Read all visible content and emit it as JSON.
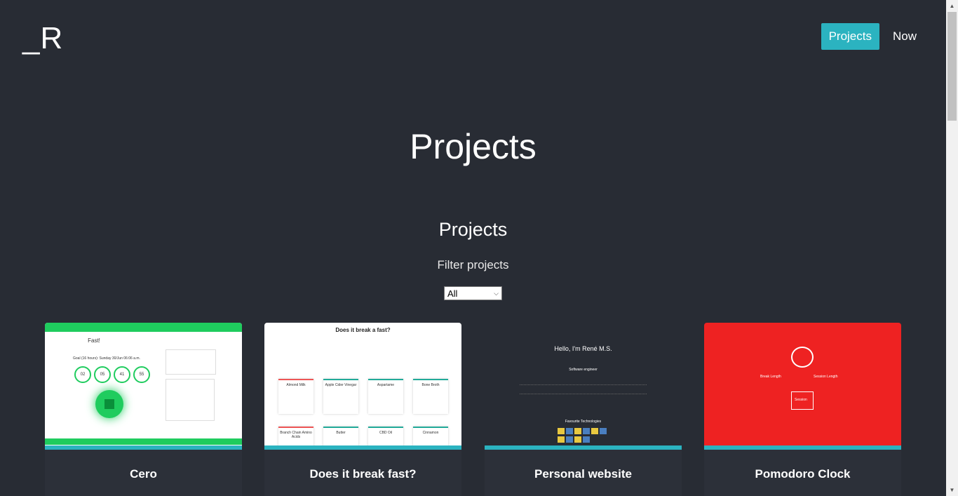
{
  "brand": {
    "logo": "_R"
  },
  "nav": [
    {
      "label": "Projects",
      "active": true
    },
    {
      "label": "Now",
      "active": false
    }
  ],
  "hero": {
    "title": "Projects"
  },
  "section": {
    "title": "Projects",
    "filter_label": "Filter projects"
  },
  "filter": {
    "selected": "All"
  },
  "cards": [
    {
      "name": "Cero"
    },
    {
      "name": "Does it break fast?"
    },
    {
      "name": "Personal website"
    },
    {
      "name": "Pomodoro Clock"
    }
  ],
  "thumbs": {
    "cero": {
      "title": "Fast!",
      "goal": "Goal (16 hours): Sunday 30/Jun 06:06 a.m.",
      "circles": [
        "02",
        "05",
        "41",
        "55"
      ]
    },
    "fast": {
      "title": "Does it break a fast?",
      "items": [
        "Almond Milk",
        "Apple Cider Vinegar",
        "Aspartame",
        "Bone Broth",
        "Branch Chain Amino Acids",
        "Butter",
        "CBD Oil",
        "Cinnamon"
      ]
    },
    "personal": {
      "hello": "Hello, I'm René M.S.",
      "sub": "Software engineer",
      "fav": "Favourite Technologies"
    },
    "pomodoro": {
      "break": "Break Length",
      "session": "Session Length",
      "box": "Session"
    }
  },
  "colors": {
    "background": "#282c34",
    "accent": "#2bb3c0",
    "cero_green": "#1fcc5e",
    "pomodoro_red": "#ee2222"
  }
}
